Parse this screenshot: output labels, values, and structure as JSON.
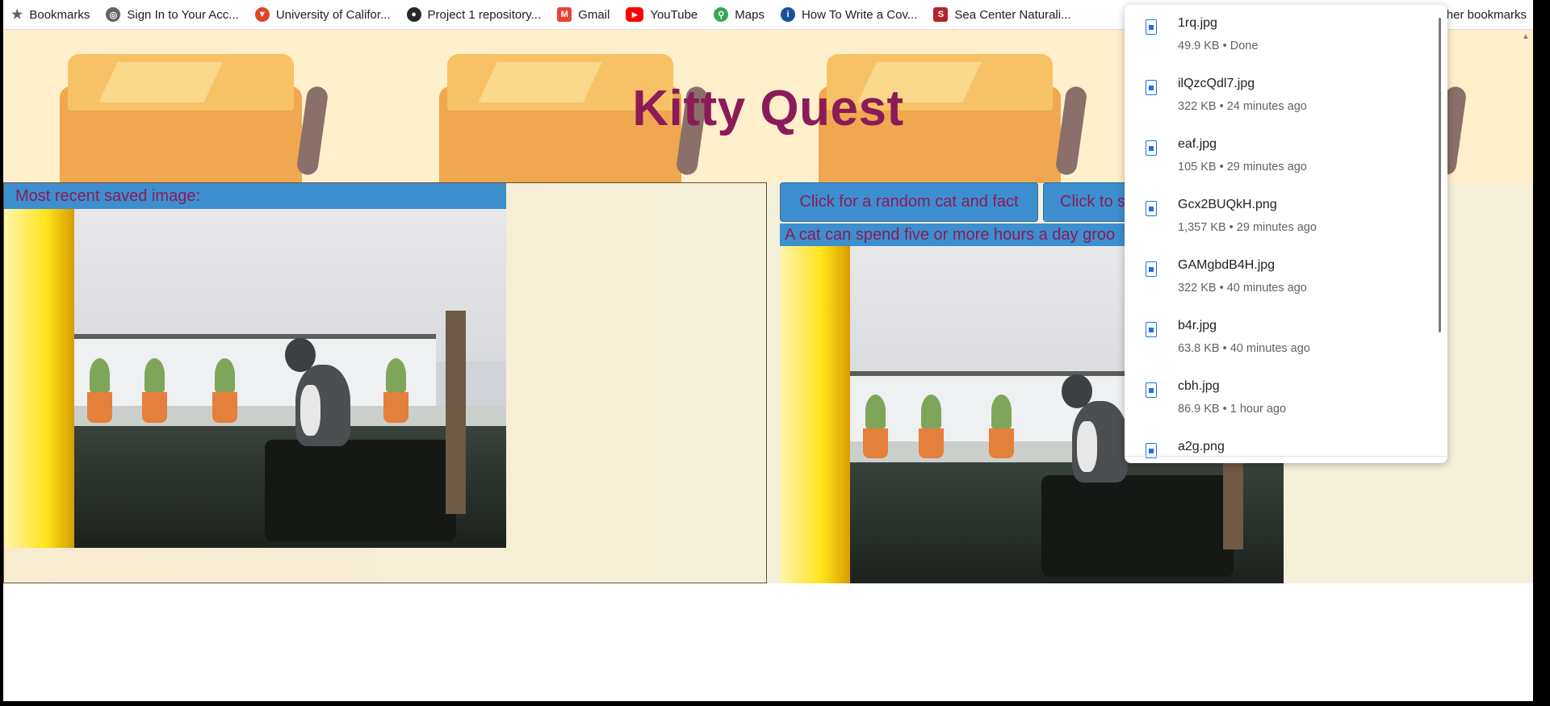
{
  "bookmarks": {
    "items": [
      {
        "label": "Bookmarks",
        "icon": "star-icon",
        "color": "#5f6368",
        "glyph": "★"
      },
      {
        "label": "Sign In to Your Acc...",
        "icon": "globe-icon",
        "color": "#5f6368",
        "glyph": "◎"
      },
      {
        "label": "University of Califor...",
        "icon": "gitlab-icon",
        "color": "#e24329",
        "glyph": "▼"
      },
      {
        "label": "Project 1 repository...",
        "icon": "github-icon",
        "color": "#24292e",
        "glyph": "●"
      },
      {
        "label": "Gmail",
        "icon": "gmail-icon",
        "color": "#ea4335",
        "glyph": "M"
      },
      {
        "label": "YouTube",
        "icon": "youtube-icon",
        "color": "#ff0000",
        "glyph": "▶"
      },
      {
        "label": "Maps",
        "icon": "maps-pin-icon",
        "color": "#34a853",
        "glyph": "⚲"
      },
      {
        "label": "How To Write a Cov...",
        "icon": "info-icon",
        "color": "#1a4f9c",
        "glyph": "i"
      },
      {
        "label": "Sea Center Naturali...",
        "icon": "sea-center-icon",
        "color": "#b4232a",
        "glyph": "S"
      }
    ],
    "other": "Other bookmarks"
  },
  "page": {
    "title": "Kitty Quest",
    "left_label": "Most recent saved image:",
    "buttons": {
      "random_cat": "Click for a random cat and fact",
      "save": "Click to s"
    },
    "fact": "A cat can spend five or more hours a day groo"
  },
  "downloads": {
    "items": [
      {
        "name": "1rq.jpg",
        "meta": "49.9 KB • Done"
      },
      {
        "name": "ilQzcQdl7.jpg",
        "meta": "322 KB • 24 minutes ago"
      },
      {
        "name": "eaf.jpg",
        "meta": "105 KB • 29 minutes ago"
      },
      {
        "name": "Gcx2BUQkH.png",
        "meta": "1,357 KB • 29 minutes ago"
      },
      {
        "name": "GAMgbdB4H.jpg",
        "meta": "322 KB • 40 minutes ago"
      },
      {
        "name": "b4r.jpg",
        "meta": "63.8 KB • 40 minutes ago"
      },
      {
        "name": "cbh.jpg",
        "meta": "86.9 KB • 1 hour ago"
      },
      {
        "name": "a2g.png",
        "meta": ""
      }
    ]
  },
  "colors": {
    "title": "#8b1b58",
    "button_bg": "#3d8fcf",
    "hero_bg": "#ffefcb",
    "page_bg": "#f5f0da"
  }
}
